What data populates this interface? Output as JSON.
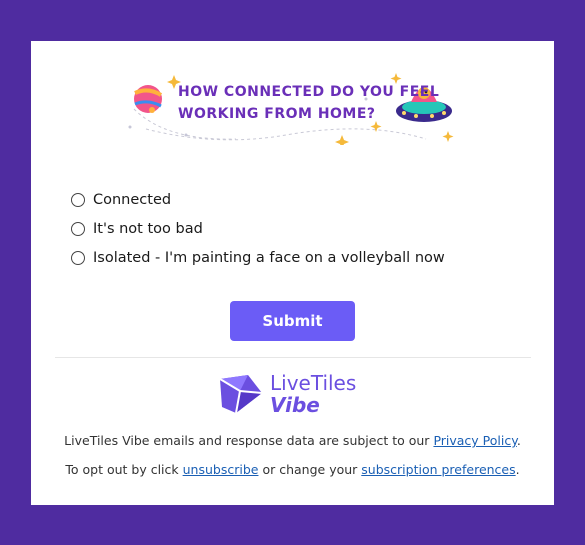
{
  "banner": {
    "line1": "How connected do you feel",
    "line2": "working from home?"
  },
  "options": [
    {
      "label": "Connected"
    },
    {
      "label": "It's not too bad"
    },
    {
      "label": "Isolated - I'm painting a face on a volleyball now"
    }
  ],
  "submit_label": "Submit",
  "logo": {
    "line1": "LiveTiles",
    "line2": "Vibe"
  },
  "footer": {
    "line1_text": "LiveTiles Vibe emails and response data are subject to our",
    "privacy_link": "Privacy Policy",
    "line1_end": ".",
    "line2_start": "To opt out by click",
    "unsubscribe_link": "unsubscribe",
    "line2_middle": "or change your",
    "preferences_link": "subscription preferences",
    "line2_end": "."
  },
  "colors": {
    "background": "#4f2ca0",
    "accent": "#6b5cf6",
    "banner_text": "#6a2fb8",
    "link": "#1a5fb4"
  }
}
